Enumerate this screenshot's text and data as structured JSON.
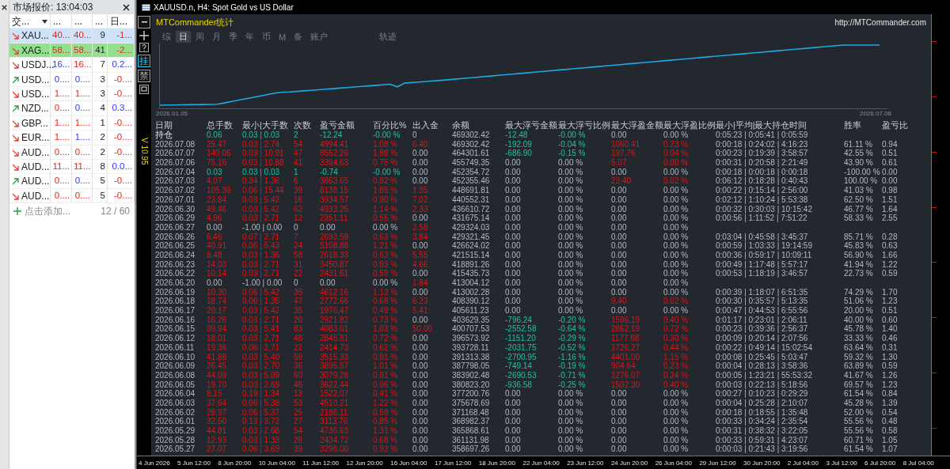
{
  "market_watch": {
    "title": "市场报价: 13:04:03",
    "columns": [
      "交...",
      "...",
      "...",
      "...",
      "日..."
    ],
    "rows": [
      {
        "symbol": "XAU...",
        "trend_up": false,
        "bid": "40...",
        "bid_up": false,
        "ask": "40...",
        "ask_up": false,
        "spread": "9",
        "change": "-1...",
        "change_up": false,
        "selected": true,
        "highlighted": false
      },
      {
        "symbol": "XAG...",
        "trend_up": false,
        "bid": "58...",
        "bid_up": false,
        "ask": "58...",
        "ask_up": false,
        "spread": "41",
        "change": "-2...",
        "change_up": false,
        "selected": false,
        "highlighted": true
      },
      {
        "symbol": "USDJ...",
        "trend_up": false,
        "bid": "16...",
        "bid_up": true,
        "ask": "16...",
        "ask_up": false,
        "spread": "7",
        "change": "0.2...",
        "change_up": true,
        "selected": false,
        "highlighted": false
      },
      {
        "symbol": "USD...",
        "trend_up": true,
        "bid": "0....",
        "bid_up": true,
        "ask": "0....",
        "ask_up": true,
        "spread": "3",
        "change": "-0....",
        "change_up": false,
        "selected": false,
        "highlighted": false
      },
      {
        "symbol": "USD...",
        "trend_up": false,
        "bid": "1....",
        "bid_up": false,
        "ask": "1....",
        "ask_up": false,
        "spread": "3",
        "change": "-0....",
        "change_up": false,
        "selected": false,
        "highlighted": false
      },
      {
        "symbol": "NZD...",
        "trend_up": true,
        "bid": "0....",
        "bid_up": false,
        "ask": "0....",
        "ask_up": true,
        "spread": "4",
        "change": "0.3...",
        "change_up": true,
        "selected": false,
        "highlighted": false
      },
      {
        "symbol": "GBP...",
        "trend_up": false,
        "bid": "1....",
        "bid_up": false,
        "ask": "1....",
        "ask_up": false,
        "spread": "1",
        "change": "-0....",
        "change_up": false,
        "selected": false,
        "highlighted": false
      },
      {
        "symbol": "EUR...",
        "trend_up": false,
        "bid": "1....",
        "bid_up": false,
        "ask": "1....",
        "ask_up": true,
        "spread": "2",
        "change": "-0....",
        "change_up": false,
        "selected": false,
        "highlighted": false
      },
      {
        "symbol": "AUD...",
        "trend_up": false,
        "bid": "0....",
        "bid_up": false,
        "ask": "0....",
        "ask_up": false,
        "spread": "2",
        "change": "-0....",
        "change_up": false,
        "selected": false,
        "highlighted": false
      },
      {
        "symbol": "AUD...",
        "trend_up": false,
        "bid": "11...",
        "bid_up": false,
        "ask": "11...",
        "ask_up": false,
        "spread": "8",
        "change": "0.0...",
        "change_up": true,
        "selected": false,
        "highlighted": false
      },
      {
        "symbol": "AUD...",
        "trend_up": true,
        "bid": "0....",
        "bid_up": false,
        "ask": "0....",
        "ask_up": true,
        "spread": "5",
        "change": "-0....",
        "change_up": false,
        "selected": false,
        "highlighted": false
      },
      {
        "symbol": "AUD...",
        "trend_up": false,
        "bid": "0....",
        "bid_up": false,
        "ask": "0....",
        "ask_up": false,
        "spread": "5",
        "change": "-0....",
        "change_up": false,
        "selected": false,
        "highlighted": false
      }
    ],
    "add_label": "点击添加...",
    "count": "12 / 60"
  },
  "chart": {
    "title": "XAUUSD.n, H4: Spot Gold vs US Dollar",
    "version": "V 10.95",
    "toolbar_labels": [
      "挂",
      "禁"
    ],
    "time_axis": [
      "4 Jun 2026",
      "5 Jun 12:00",
      "8 Jun 20:00",
      "10 Jun 04:00",
      "11 Jun 12:00",
      "12 Jun 20:00",
      "16 Jun 04:00",
      "17 Jun 12:00",
      "18 Jun 20:00",
      "22 Jun 04:00",
      "23 Jun 12:00",
      "24 Jun 20:00",
      "26 Jun 04:00",
      "29 Jun 12:00",
      "30 Jun 20:00",
      "2 Jul 04:00",
      "3 Jul 12:00",
      "6 Jul 20:00",
      "8 Jul 04:00"
    ]
  },
  "stats": {
    "title": "MTCommander统计",
    "link": "http://MTCommander.com",
    "tabs": [
      {
        "label": "综",
        "selected": false
      },
      {
        "label": "日",
        "selected": true
      },
      {
        "label": "周",
        "selected": false
      },
      {
        "label": "月",
        "selected": false
      },
      {
        "label": "季",
        "selected": false
      },
      {
        "label": "年",
        "selected": false
      },
      {
        "label": "币",
        "selected": false
      },
      {
        "label": "M",
        "selected": false
      },
      {
        "label": "备",
        "selected": false
      },
      {
        "label": "账户",
        "selected": false
      }
    ],
    "trace_button": "轨迹",
    "equity_start": "2026.01.05",
    "equity_end": "2026.07.08",
    "columns": [
      "日期",
      "总手数",
      "最小|大手数",
      "次数",
      "盈亏金额",
      "百分比%",
      "出入金",
      "余额",
      "最大浮亏金额",
      "最大浮亏比例",
      "最大浮盈金额",
      "最大浮盈比例",
      "最小|平均|最大持仓时间",
      "胜率",
      "盈亏比"
    ],
    "rows": [
      {
        "cells": [
          "持仓",
          "0.06",
          "0.03 | 0.03",
          "2",
          "-12.24",
          "-0.00 %",
          "0",
          "469302.42",
          "-12.48",
          "-0.00 %",
          "0.00",
          "0.00 %",
          "0:05:23 | 0:05:41 | 0:05:59"
        ],
        "profit_marked": false,
        "loss_marked": true,
        "deposit_marked": false,
        "float_loss_marked": true,
        "float_profit_marked": false
      },
      {
        "cells": [
          "2026.07.08",
          "25.47",
          "0.03 | 2.74",
          "54",
          "4994.41",
          "1.08 %",
          "6.40",
          "469302.42",
          "-192.09",
          "-0.04 %",
          "1060.41",
          "0.23 %",
          "0:00:18 | 0:24:02 | 4:16:23",
          "61.11 %",
          "0.94"
        ],
        "profit_marked": true,
        "loss_marked": false,
        "deposit_marked": true,
        "float_loss_marked": true,
        "float_profit_marked": true
      },
      {
        "cells": [
          "2026.07.07",
          "140.06",
          "0.03 | 10.91",
          "47",
          "8552.26",
          "1.88 %",
          "0.00",
          "464301.61",
          "-686.90",
          "-0.15 %",
          "197.76",
          "0.04 %",
          "0:00:23 | 0:19:39 | 3:58:57",
          "42.55 %",
          "0.51"
        ],
        "profit_marked": true,
        "loss_marked": false,
        "deposit_marked": false,
        "float_loss_marked": true,
        "float_profit_marked": true
      },
      {
        "cells": [
          "2026.07.06",
          "75.16",
          "0.03 | 10.88",
          "41",
          "3394.63",
          "0.75 %",
          "0.00",
          "455749.35",
          "0.00",
          "0.00 %",
          "5.07",
          "0.00 %",
          "0:00:31 | 0:20:58 | 2:21:49",
          "43.90 %",
          "0.61"
        ],
        "profit_marked": true,
        "loss_marked": false,
        "deposit_marked": false,
        "float_loss_marked": false,
        "float_profit_marked": true
      },
      {
        "cells": [
          "2026.07.04",
          "0.03",
          "0.03 | 0.03",
          "1",
          "-0.74",
          "-0.00 %",
          "0.00",
          "452354.72",
          "0.00",
          "0.00 %",
          "0.00",
          "0.00 %",
          "0:00:18 | 0:00:18 | 0:00:18",
          "-100.00 %",
          "0.00"
        ],
        "profit_marked": false,
        "loss_marked": true,
        "deposit_marked": false,
        "float_loss_marked": false,
        "float_profit_marked": false
      },
      {
        "cells": [
          "2026.07.03",
          "4.07",
          "0.34 | 1.36",
          "6",
          "3663.65",
          "0.82 %",
          "0.00",
          "452355.46",
          "0.00",
          "0.00 %",
          "23.40",
          "0.02 %",
          "0:06:12 | 0:18:28 | 0:40:43",
          "100.00 %",
          "0.00"
        ],
        "profit_marked": true,
        "loss_marked": false,
        "deposit_marked": false,
        "float_loss_marked": false,
        "float_profit_marked": true
      },
      {
        "cells": [
          "2026.07.02",
          "105.39",
          "0.06 | 15.44",
          "39",
          "8138.15",
          "1.85 %",
          "1.35",
          "448691.81",
          "0.00",
          "0.00 %",
          "0.00",
          "0.00 %",
          "0:00:22 | 0:15:14 | 2:56:00",
          "41.03 %",
          "0.98"
        ],
        "profit_marked": true,
        "loss_marked": false,
        "deposit_marked": true,
        "float_loss_marked": false,
        "float_profit_marked": false
      },
      {
        "cells": [
          "2026.07.01",
          "23.84",
          "0.03 | 5.42",
          "16",
          "3934.57",
          "0.90 %",
          "7.02",
          "440552.31",
          "0.00",
          "0.00 %",
          "0.00",
          "0.00 %",
          "0:02:12 | 1:10:24 | 5:53:38",
          "62.50 %",
          "1.51"
        ],
        "profit_marked": true,
        "loss_marked": false,
        "deposit_marked": true,
        "float_loss_marked": false,
        "float_profit_marked": false
      },
      {
        "cells": [
          "2026.06.30",
          "49.46",
          "0.03 | 5.42",
          "62",
          "4933.25",
          "1.14 %",
          "2.33",
          "436610.72",
          "0.00",
          "0.00 %",
          "0.00",
          "0.00 %",
          "0:00:32 | 0:30:03 | 10:15:42",
          "46.77 %",
          "1.64"
        ],
        "profit_marked": true,
        "loss_marked": false,
        "deposit_marked": true,
        "float_loss_marked": false,
        "float_profit_marked": false
      },
      {
        "cells": [
          "2026.06.29",
          "4.96",
          "0.03 | 2.71",
          "12",
          "2351.11",
          "0.55 %",
          "0.00",
          "431675.14",
          "0.00",
          "0.00 %",
          "0.00",
          "0.00 %",
          "0:00:56 | 1:11:52 | 7:51:22",
          "58.33 %",
          "2.55"
        ],
        "profit_marked": true,
        "loss_marked": false,
        "deposit_marked": false,
        "float_loss_marked": false,
        "float_profit_marked": false
      },
      {
        "cells": [
          "2026.06.27",
          "0.00",
          "-1.00 | 0.00",
          "0",
          "0.00",
          "0.00 %",
          "2.58",
          "429324.03",
          "0.00",
          "0.00 %",
          "0.00",
          "0.00 %"
        ],
        "profit_marked": false,
        "loss_marked": false,
        "deposit_marked": true,
        "float_loss_marked": false,
        "float_profit_marked": false
      },
      {
        "cells": [
          "2026.06.26",
          "6.46",
          "0.07 | 2.71",
          "7",
          "2693.59",
          "0.63 %",
          "3.84",
          "429321.45",
          "0.00",
          "0.00 %",
          "0.00",
          "0.00 %",
          "0:03:04 | 0:45:58 | 3:45:37",
          "85.71 %",
          "0.28"
        ],
        "profit_marked": true,
        "loss_marked": false,
        "deposit_marked": true,
        "float_loss_marked": false,
        "float_profit_marked": false
      },
      {
        "cells": [
          "2026.06.25",
          "40.91",
          "0.06 | 5.43",
          "24",
          "5108.88",
          "1.21 %",
          "0.00",
          "426624.02",
          "0.00",
          "0.00 %",
          "0.00",
          "0.00 %",
          "0:00:59 | 1:03:33 | 19:14:59",
          "45.83 %",
          "0.63"
        ],
        "profit_marked": true,
        "loss_marked": false,
        "deposit_marked": false,
        "float_loss_marked": false,
        "float_profit_marked": false
      },
      {
        "cells": [
          "2026.06.24",
          "8.48",
          "0.03 | 1.36",
          "58",
          "2618.33",
          "0.63 %",
          "5.55",
          "421515.14",
          "0.00",
          "0.00 %",
          "0.00",
          "0.00 %",
          "0:00:36 | 0:59:17 | 10:09:11",
          "56.90 %",
          "1.66"
        ],
        "profit_marked": true,
        "loss_marked": false,
        "deposit_marked": true,
        "float_loss_marked": false,
        "float_profit_marked": false
      },
      {
        "cells": [
          "2026.06.23",
          "14.03",
          "0.03 | 2.71",
          "31",
          "3450.87",
          "0.83 %",
          "4.66",
          "418891.26",
          "0.00",
          "0.00 %",
          "0.00",
          "0.00 %",
          "0:00:49 | 1:17:48 | 5:57:17",
          "41.94 %",
          "1.22"
        ],
        "profit_marked": true,
        "loss_marked": false,
        "deposit_marked": true,
        "float_loss_marked": false,
        "float_profit_marked": false
      },
      {
        "cells": [
          "2026.06.22",
          "10.14",
          "0.03 | 2.71",
          "22",
          "2431.61",
          "0.59 %",
          "0.00",
          "415435.73",
          "0.00",
          "0.00 %",
          "0.00",
          "0.00 %",
          "0:00:53 | 1:18:19 | 3:46:57",
          "22.73 %",
          "0.59"
        ],
        "profit_marked": true,
        "loss_marked": false,
        "deposit_marked": false,
        "float_loss_marked": false,
        "float_profit_marked": false
      },
      {
        "cells": [
          "2026.06.20",
          "0.00",
          "-1.00 | 0.00",
          "0",
          "0.00",
          "0.00 %",
          "1.84",
          "413004.12",
          "0.00",
          "0.00 %",
          "0.00",
          "0.00 %"
        ],
        "profit_marked": false,
        "loss_marked": false,
        "deposit_marked": true,
        "float_loss_marked": false,
        "float_profit_marked": false
      },
      {
        "cells": [
          "2026.06.19",
          "10.30",
          "0.06 | 5.42",
          "35",
          "4612.16",
          "1.13 %",
          "0.00",
          "413002.28",
          "0.00",
          "0.00 %",
          "0.00",
          "0.00 %",
          "0:00:39 | 1:18:07 | 6:51:35",
          "74.29 %",
          "1.70"
        ],
        "profit_marked": true,
        "loss_marked": false,
        "deposit_marked": false,
        "float_loss_marked": false,
        "float_profit_marked": false
      },
      {
        "cells": [
          "2026.06.18",
          "18.74",
          "0.06 | 1.35",
          "47",
          "2772.66",
          "0.68 %",
          "6.23",
          "408390.12",
          "0.00",
          "0.00 %",
          "9.40",
          "0.02 %",
          "0:00:30 | 0:35:57 | 5:13:35",
          "51.06 %",
          "1.23"
        ],
        "profit_marked": true,
        "loss_marked": false,
        "deposit_marked": true,
        "float_loss_marked": false,
        "float_profit_marked": true
      },
      {
        "cells": [
          "2026.06.17",
          "20.17",
          "0.03 | 5.42",
          "35",
          "1976.47",
          "0.49 %",
          "5.41",
          "405611.23",
          "0.00",
          "0.00 %",
          "0.00",
          "0.00 %",
          "0:00:47 | 0:44:53 | 6:55:56",
          "20.00 %",
          "0.51"
        ],
        "profit_marked": true,
        "loss_marked": false,
        "deposit_marked": true,
        "float_loss_marked": false,
        "float_profit_marked": false
      },
      {
        "cells": [
          "2026.06.16",
          "16.28",
          "0.03 | 2.71",
          "20",
          "2921.82",
          "0.73 %",
          "0.00",
          "403629.35",
          "-796.24",
          "-0.20 %",
          "1596.19",
          "0.40 %",
          "0:01:17 | 0:23:01 | 2:06:11",
          "40.00 %",
          "0.60"
        ],
        "profit_marked": true,
        "loss_marked": false,
        "deposit_marked": false,
        "float_loss_marked": true,
        "float_profit_marked": true
      },
      {
        "cells": [
          "2026.06.15",
          "39.94",
          "0.03 | 5.41",
          "83",
          "4083.61",
          "1.03 %",
          "50.00",
          "400707.53",
          "-2552.58",
          "-0.64 %",
          "2862.19",
          "0.72 %",
          "0:00:23 | 0:39:36 | 2:56:37",
          "45.78 %",
          "1.40"
        ],
        "profit_marked": true,
        "loss_marked": false,
        "deposit_marked": true,
        "float_loss_marked": true,
        "float_profit_marked": true
      },
      {
        "cells": [
          "2026.06.12",
          "18.01",
          "0.03 | 2.71",
          "48",
          "2845.81",
          "0.72 %",
          "0.00",
          "396573.92",
          "-1151.20",
          "-0.29 %",
          "1177.68",
          "0.30 %",
          "0:00:09 | 0:20:14 | 2:07:56",
          "33.33 %",
          "0.46"
        ],
        "profit_marked": true,
        "loss_marked": false,
        "deposit_marked": false,
        "float_loss_marked": true,
        "float_profit_marked": true
      },
      {
        "cells": [
          "2026.06.11",
          "19.36",
          "0.06 | 2.71",
          "22",
          "2414.73",
          "0.62 %",
          "0.00",
          "393728.11",
          "-2031.75",
          "-0.52 %",
          "1726.27",
          "0.44 %",
          "0:00:22 | 0:49:14 | 15:02:54",
          "63.64 %",
          "0.31"
        ],
        "profit_marked": true,
        "loss_marked": false,
        "deposit_marked": false,
        "float_loss_marked": true,
        "float_profit_marked": true
      },
      {
        "cells": [
          "2026.06.10",
          "41.88",
          "0.03 | 5.40",
          "59",
          "3515.33",
          "0.91 %",
          "0.00",
          "391313.38",
          "-2700.95",
          "-1.16 %",
          "4401.00",
          "1.15 %",
          "0:00:08 | 0:25:45 | 5:03:47",
          "59.32 %",
          "1.30"
        ],
        "profit_marked": true,
        "loss_marked": false,
        "deposit_marked": false,
        "float_loss_marked": true,
        "float_profit_marked": true
      },
      {
        "cells": [
          "2026.06.09",
          "26.45",
          "0.03 | 2.70",
          "36",
          "3895.57",
          "1.01 %",
          "0.00",
          "387798.05",
          "-749.14",
          "-0.19 %",
          "904.64",
          "0.23 %",
          "0:00:04 | 0:28:13 | 3:58:36",
          "63.89 %",
          "0.59"
        ],
        "profit_marked": true,
        "loss_marked": false,
        "deposit_marked": false,
        "float_loss_marked": true,
        "float_profit_marked": true
      },
      {
        "cells": [
          "2026.06.08",
          "44.09",
          "0.03 | 5.09",
          "60",
          "3079.28",
          "0.81 %",
          "0.00",
          "383902.48",
          "-2690.53",
          "-0.71 %",
          "1276.07",
          "0.34 %",
          "0:00:05 | 1:23:21 | 55:53:32",
          "41.67 %",
          "1.26"
        ],
        "profit_marked": true,
        "loss_marked": false,
        "deposit_marked": false,
        "float_loss_marked": true,
        "float_profit_marked": true
      },
      {
        "cells": [
          "2026.06.05",
          "19.70",
          "0.03 | 2.69",
          "46",
          "3622.44",
          "0.96 %",
          "0.00",
          "380823.20",
          "-936.58",
          "-0.25 %",
          "1502.30",
          "0.40 %",
          "0:00:03 | 0:22:13 | 5:18:56",
          "69.57 %",
          "1.23"
        ],
        "profit_marked": true,
        "loss_marked": false,
        "deposit_marked": false,
        "float_loss_marked": true,
        "float_profit_marked": true
      },
      {
        "cells": [
          "2026.06.04",
          "8.15",
          "0.19 | 1.34",
          "13",
          "1522.07",
          "0.41 %",
          "0.00",
          "377200.76",
          "0.00",
          "0.00 %",
          "0.00",
          "0.00 %",
          "0:00:27 | 0:10:23 | 0:29:29",
          "61.54 %",
          "0.84"
        ],
        "profit_marked": true,
        "loss_marked": false,
        "deposit_marked": false,
        "float_loss_marked": false,
        "float_profit_marked": false
      },
      {
        "cells": [
          "2026.06.03",
          "37.64",
          "0.06 | 5.38",
          "53",
          "4510.21",
          "1.22 %",
          "0.00",
          "375678.69",
          "0.00",
          "0.00 %",
          "0.00",
          "0.00 %",
          "0:00:04 | 0:25:28 | 2:10:07",
          "45.28 %",
          "1.39"
        ],
        "profit_marked": true,
        "loss_marked": false,
        "deposit_marked": false,
        "float_loss_marked": false,
        "float_profit_marked": false
      },
      {
        "cells": [
          "2026.06.02",
          "28.97",
          "0.06 | 5.37",
          "25",
          "2186.11",
          "0.59 %",
          "0.00",
          "371168.48",
          "0.00",
          "0.00 %",
          "0.00",
          "0.00 %",
          "0:00:18 | 0:18:55 | 1:35:48",
          "52.00 %",
          "0.54"
        ],
        "profit_marked": true,
        "loss_marked": false,
        "deposit_marked": false,
        "float_loss_marked": false,
        "float_profit_marked": false
      },
      {
        "cells": [
          "2026.06.01",
          "32.50",
          "0.13 | 3.72",
          "27",
          "3113.76",
          "0.85 %",
          "0.00",
          "368982.37",
          "0.00",
          "0.00 %",
          "0.00",
          "0.00 %",
          "0:00:33 | 0:34:24 | 2:35:54",
          "55.56 %",
          "0.48"
        ],
        "profit_marked": true,
        "loss_marked": false,
        "deposit_marked": false,
        "float_loss_marked": false,
        "float_profit_marked": false
      },
      {
        "cells": [
          "2026.05.29",
          "44.81",
          "0.03 | 2.68",
          "54",
          "4736.63",
          "1.31 %",
          "0.00",
          "365868.61",
          "0.00",
          "0.00 %",
          "0.00",
          "0.00 %",
          "0:00:31 | 0:38:32 | 3:22:05",
          "55.56 %",
          "0.58"
        ],
        "profit_marked": true,
        "loss_marked": false,
        "deposit_marked": false,
        "float_loss_marked": false,
        "float_profit_marked": false
      },
      {
        "cells": [
          "2026.05.28",
          "12.93",
          "0.03 | 1.33",
          "28",
          "2434.72",
          "0.68 %",
          "0.00",
          "361131.98",
          "0.00",
          "0.00 %",
          "0.00",
          "0.00 %",
          "0:00:33 | 0:59:31 | 4:23:07",
          "60.71 %",
          "1.05"
        ],
        "profit_marked": true,
        "loss_marked": false,
        "deposit_marked": false,
        "float_loss_marked": false,
        "float_profit_marked": false
      },
      {
        "cells": [
          "2026.05.27",
          "27.07",
          "0.06 | 3.69",
          "39",
          "3296.00",
          "0.93 %",
          "0.00",
          "358697.26",
          "0.00",
          "0.00 %",
          "0.00",
          "0.00 %",
          "0:00:03 | 0:21:43 | 3:19:56",
          "61.54 %",
          "1.07"
        ],
        "profit_marked": true,
        "loss_marked": false,
        "deposit_marked": false,
        "float_loss_marked": false,
        "float_profit_marked": false
      }
    ]
  }
}
